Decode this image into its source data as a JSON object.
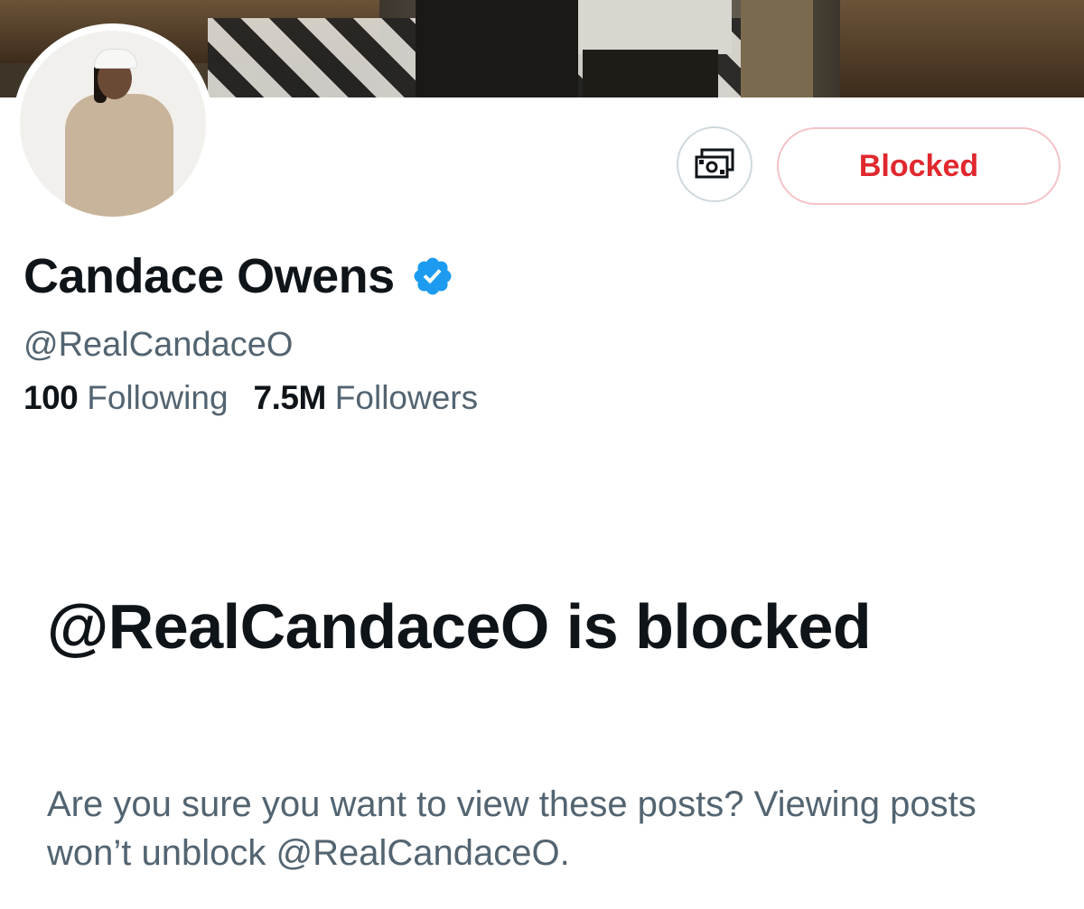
{
  "profile": {
    "display_name": "Candace Owens",
    "handle": "@RealCandaceO",
    "verified": true,
    "following_count": "100",
    "following_label": "Following",
    "followers_count": "7.5M",
    "followers_label": "Followers"
  },
  "actions": {
    "tip_icon": "money-icon",
    "blocked_label": "Blocked"
  },
  "blocked_notice": {
    "title": "@RealCandaceO is blocked",
    "description": "Are you sure you want to view these posts? Viewing posts won’t unblock @RealCandaceO."
  },
  "colors": {
    "blocked_red": "#e0282e",
    "blocked_border": "#f4c2c7",
    "verified_blue": "#1d9bf0",
    "text_primary": "#0f1419",
    "text_secondary": "#536471"
  }
}
